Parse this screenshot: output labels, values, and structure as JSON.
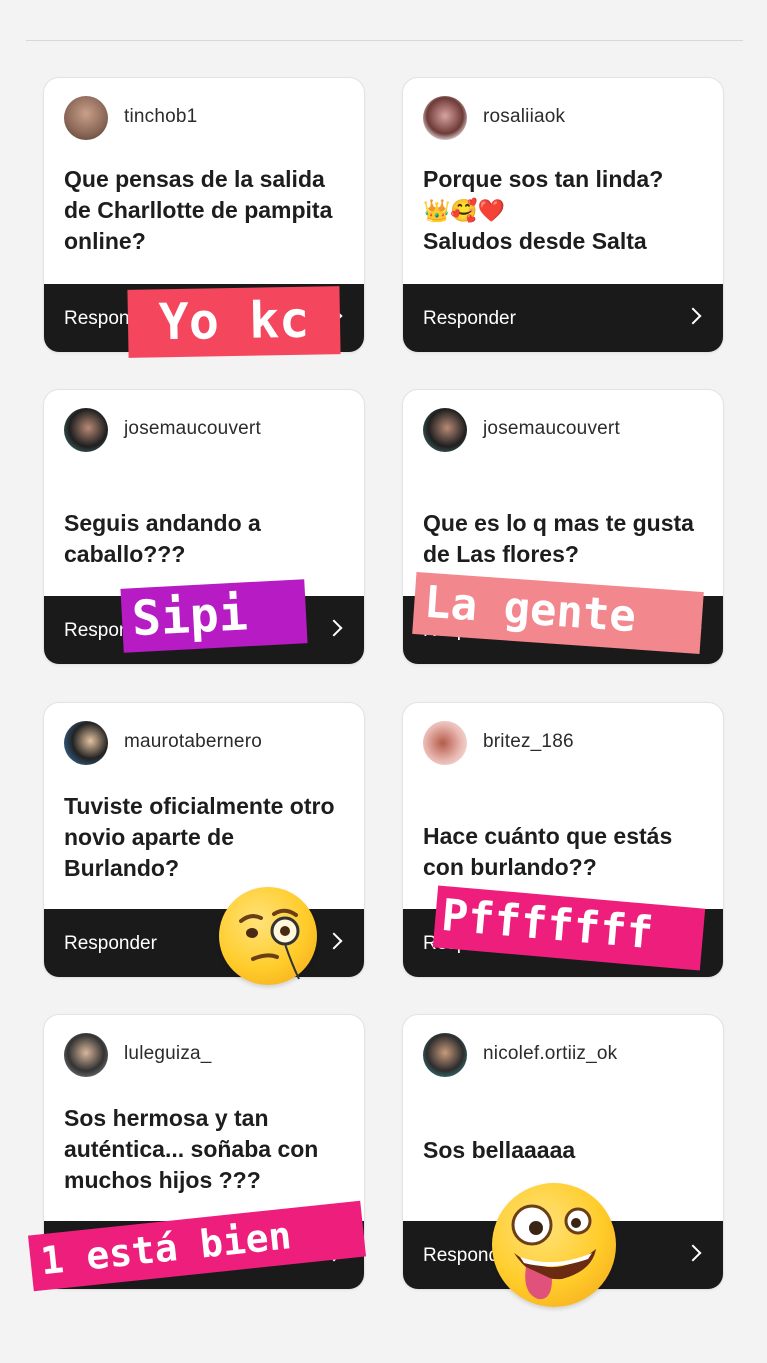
{
  "button_label": "Responder",
  "cards": [
    {
      "username": "tinchob1",
      "question": "Que pensas de la salida de Charllotte de pampita online?"
    },
    {
      "username": "rosaliiaok",
      "question_line1": "Porque sos tan linda?",
      "emojis": "👑🥰❤️",
      "question_line2": "Saludos desde Salta"
    },
    {
      "username": "josemaucouvert",
      "question": "Seguis andando a caballo???"
    },
    {
      "username": "josemaucouvert",
      "question": "Que es lo q mas te gusta de Las flores?"
    },
    {
      "username": "maurotabernero",
      "question": "Tuviste oficialmente otro novio aparte de Burlando?"
    },
    {
      "username": "britez_186",
      "question": "Hace cuánto que estás con burlando??"
    },
    {
      "username": "luleguiza_",
      "question": "Sos hermosa y tan auténtica... soñaba con muchos hijos ???"
    },
    {
      "username": "nicolef.ortiiz_ok",
      "question": "Sos bellaaaaa"
    }
  ],
  "stickers": {
    "s1": "Yo kc",
    "s2": "Sipi",
    "s3": "La gente",
    "s4": "Pfffffff",
    "s5": "1 está bien"
  },
  "emoji_stickers": [
    "monocle-face",
    "zany-face"
  ],
  "colors": {
    "bar": "#1a1a1a",
    "sticker_red": "#f4475e",
    "sticker_purple": "#b61bc4",
    "sticker_pink": "#f3878e",
    "sticker_magenta": "#ee1f7c"
  }
}
